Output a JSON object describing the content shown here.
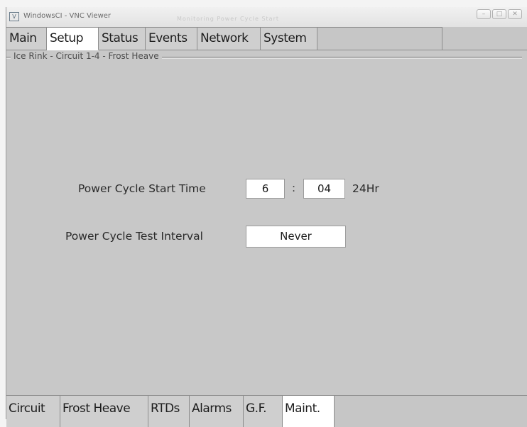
{
  "window": {
    "title": "WindowsCI - VNC Viewer",
    "faint_title": "Monitoring Power Cycle Start",
    "controls": [
      "minimize",
      "maximize",
      "close"
    ]
  },
  "top_tabs": [
    {
      "label": "Main",
      "active": false
    },
    {
      "label": "Setup",
      "active": true
    },
    {
      "label": "Status",
      "active": false
    },
    {
      "label": "Events",
      "active": false
    },
    {
      "label": "Network",
      "active": false
    },
    {
      "label": "System",
      "active": false
    }
  ],
  "group_label": "Ice Rink - Circuit 1-4 - Frost Heave",
  "power_cycle_start_time": {
    "label": "Power Cycle Start Time",
    "hour": "6",
    "minute": "04",
    "separator": ":",
    "unit": "24Hr"
  },
  "power_cycle_test_interval": {
    "label": "Power Cycle Test Interval",
    "value": "Never"
  },
  "bottom_tabs": [
    {
      "label": "Circuit",
      "active": false
    },
    {
      "label": "Frost Heave",
      "active": false
    },
    {
      "label": "RTDs",
      "active": false
    },
    {
      "label": "Alarms",
      "active": false
    },
    {
      "label": "G.F.",
      "active": false
    },
    {
      "label": "Maint.",
      "active": true
    }
  ],
  "colors": {
    "panel": "#c8c8c8",
    "active_tab": "#ffffff",
    "border": "#8e8e8e"
  }
}
